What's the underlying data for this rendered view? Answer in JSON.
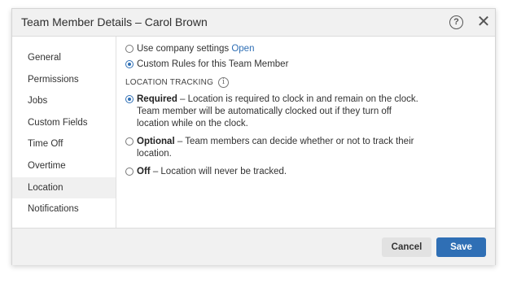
{
  "dialog": {
    "title": "Team Member Details – Carol Brown",
    "help_icon": "help-circle-icon",
    "close_icon": "close-icon"
  },
  "sidebar": {
    "items": [
      {
        "label": "General"
      },
      {
        "label": "Permissions"
      },
      {
        "label": "Jobs"
      },
      {
        "label": "Custom Fields"
      },
      {
        "label": "Time Off"
      },
      {
        "label": "Overtime"
      },
      {
        "label": "Location",
        "active": true
      },
      {
        "label": "Notifications"
      }
    ]
  },
  "content": {
    "settings_mode": {
      "company_label": "Use company settings",
      "company_link": "Open",
      "custom_label": "Custom Rules for this Team Member",
      "selected": "custom"
    },
    "location_tracking": {
      "heading": "LOCATION TRACKING",
      "selected": "required",
      "options": [
        {
          "name": "Required",
          "desc": "– Location is required to clock in and remain on the clock.",
          "line2": "Team member will be automatically clocked out if they turn off",
          "line3": "location while on the clock."
        },
        {
          "name": "Optional",
          "desc": "– Team members can decide whether or not to track their",
          "line2": "location."
        },
        {
          "name": "Off",
          "desc": "– Location will never be tracked."
        }
      ]
    }
  },
  "footer": {
    "cancel_label": "Cancel",
    "save_label": "Save"
  },
  "colors": {
    "accent": "#2f6fb5",
    "title_bg": "#f1f1f1"
  }
}
